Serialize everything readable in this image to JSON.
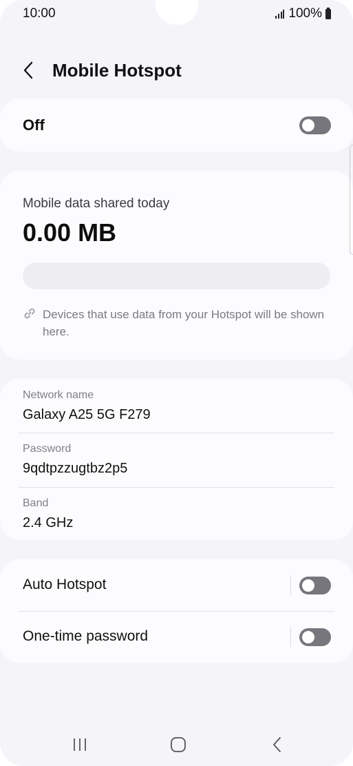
{
  "status_bar": {
    "time": "10:00",
    "battery_percent": "100%"
  },
  "header": {
    "title": "Mobile Hotspot"
  },
  "master_switch": {
    "label": "Off",
    "enabled": false
  },
  "usage": {
    "label": "Mobile data shared today",
    "value": "0.00 MB",
    "progress_fraction": 0,
    "note": "Devices that use data from your Hotspot will be shown here."
  },
  "network": {
    "items": [
      {
        "label": "Network name",
        "value": "Galaxy A25 5G F279"
      },
      {
        "label": "Password",
        "value": "9qdtpzzugtbz2p5"
      },
      {
        "label": "Band",
        "value": "2.4 GHz"
      }
    ]
  },
  "options": {
    "items": [
      {
        "label": "Auto Hotspot",
        "enabled": false
      },
      {
        "label": "One-time password",
        "enabled": false
      }
    ]
  },
  "colors": {
    "background": "#f5f4f9",
    "card": "#fcfcfe",
    "toggle_off": "#77767c"
  },
  "icons": {
    "back": "chevron-left-icon",
    "link": "link-icon",
    "nav_recents": "recents-icon",
    "nav_home": "home-icon",
    "nav_back": "back-icon"
  }
}
